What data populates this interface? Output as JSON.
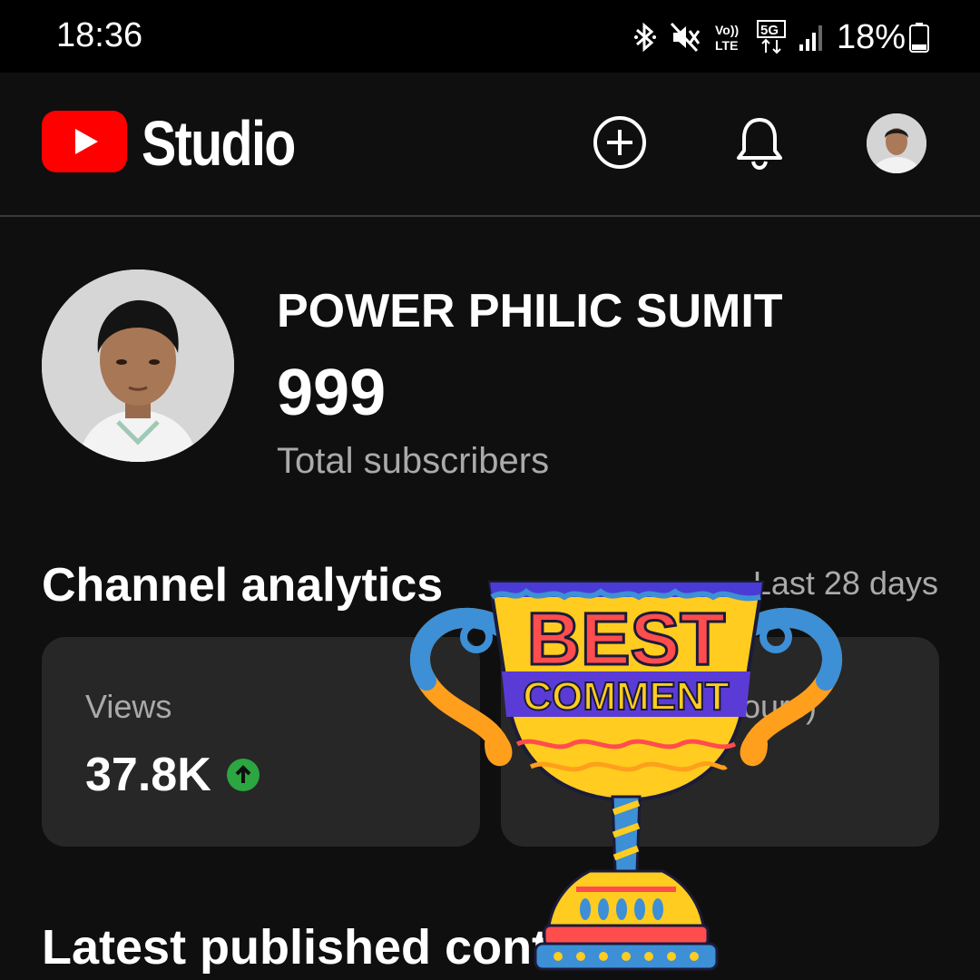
{
  "status_bar": {
    "time": "18:36",
    "battery": "18%",
    "icons": [
      "bluetooth-icon",
      "mute-icon",
      "volte-icon",
      "5g-icon",
      "signal-icon",
      "battery-icon"
    ]
  },
  "header": {
    "app_name": "Studio",
    "logo": "youtube-logo",
    "actions": [
      "create-icon",
      "notifications-bell-icon",
      "account-avatar"
    ]
  },
  "channel": {
    "name": "POWER PHILIC SUMIT",
    "subscriber_count": "999",
    "subscriber_label": "Total subscribers"
  },
  "analytics": {
    "title": "Channel analytics",
    "period": "Last 28 days",
    "cards": [
      {
        "label": "Views",
        "value": "37.8K",
        "trend": "up"
      },
      {
        "label": "hours)",
        "value": ""
      }
    ]
  },
  "latest": {
    "title": "Latest published conte"
  },
  "sticker": {
    "line1": "BEST",
    "line2": "COMMENT"
  },
  "colors": {
    "background": "#0f0f0f",
    "card": "#272727",
    "youtube_red": "#ff0000",
    "trend_green": "#2ba640",
    "secondary_text": "#aaaaaa"
  }
}
